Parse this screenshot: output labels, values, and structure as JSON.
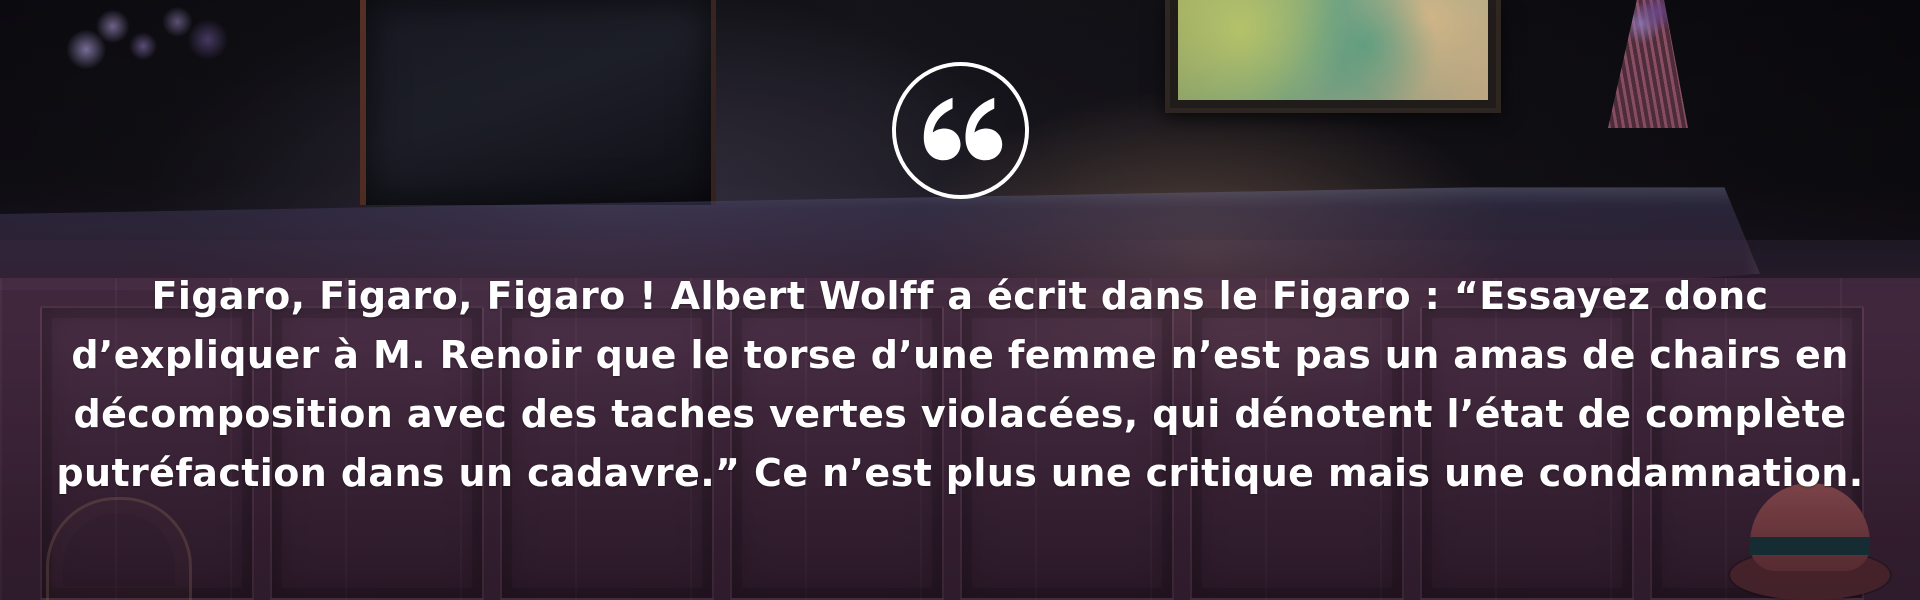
{
  "hero": {
    "icon": "quote-icon",
    "quote": "Figaro, Figaro, Figaro ! Albert Wolff a écrit dans le Figaro : “Essayez donc d’expliquer à M. Renoir que le torse d’une femme n’est pas un amas de chairs en décomposition avec des taches vertes violacées, qui dénotent l’état de complète putréfaction dans un cadavre.” Ce n’est plus une critique mais une condamnation.",
    "text_color": "#ffffff"
  }
}
